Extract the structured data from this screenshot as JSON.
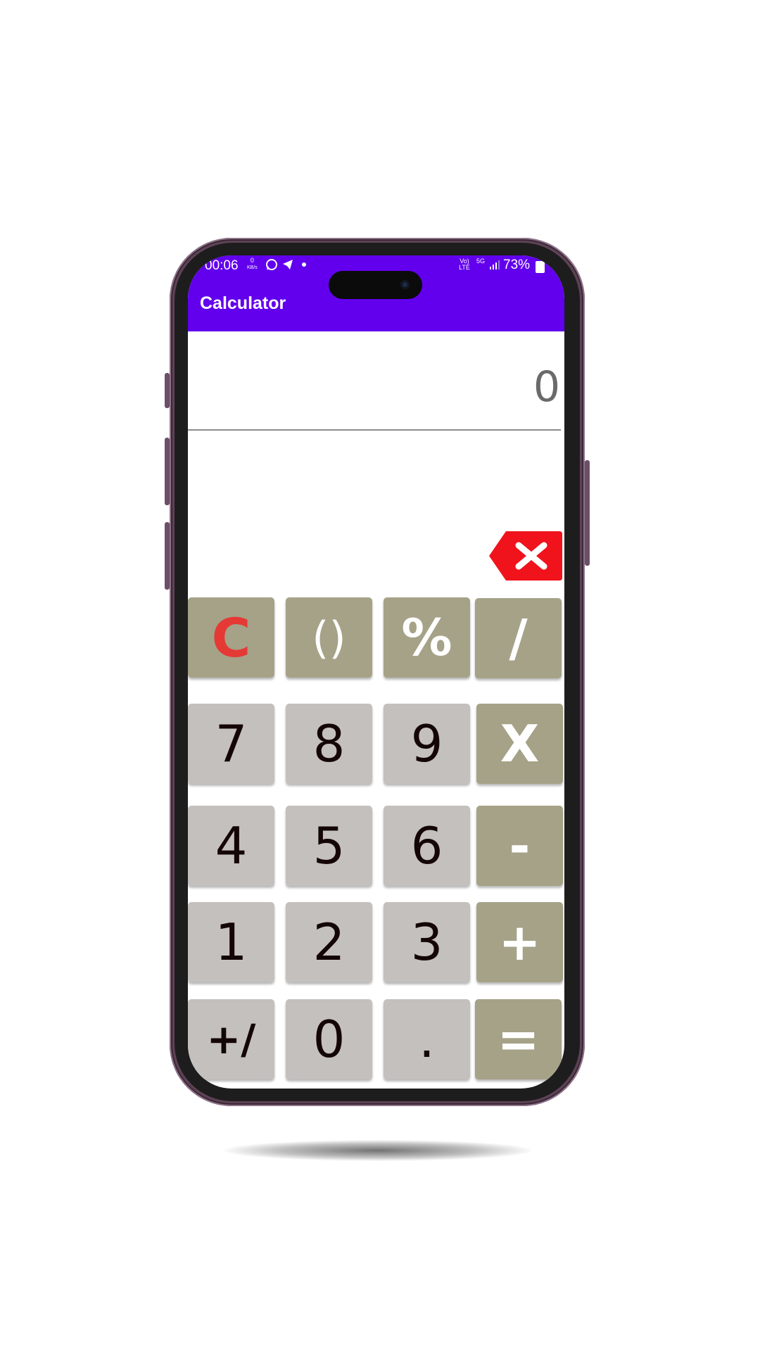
{
  "status_bar": {
    "time": "00:06",
    "data_rate_value": "0",
    "data_rate_unit": "KB/s",
    "notification_icons": [
      "whatsapp-icon",
      "telegram-icon",
      "dot-icon"
    ],
    "net_volte": "Vo) LTE",
    "net_5g": "5G",
    "battery": "73%"
  },
  "app_bar": {
    "title": "Calculator"
  },
  "display": {
    "value": "0"
  },
  "backspace": {
    "icon": "backspace-x-icon",
    "color": "#f0131c"
  },
  "keys": {
    "row1": [
      "C",
      "()",
      "%",
      "/"
    ],
    "row2": [
      "7",
      "8",
      "9",
      "X"
    ],
    "row3": [
      "4",
      "5",
      "6",
      "-"
    ],
    "row4": [
      "1",
      "2",
      "3",
      "+"
    ],
    "row5": [
      "+/",
      "0",
      ".",
      "="
    ]
  },
  "colors": {
    "app_bar": "#6200ee",
    "number_key": "#c4c0be",
    "operator_key": "#a5a288",
    "clear_text": "#e53935",
    "number_text": "#140606"
  }
}
